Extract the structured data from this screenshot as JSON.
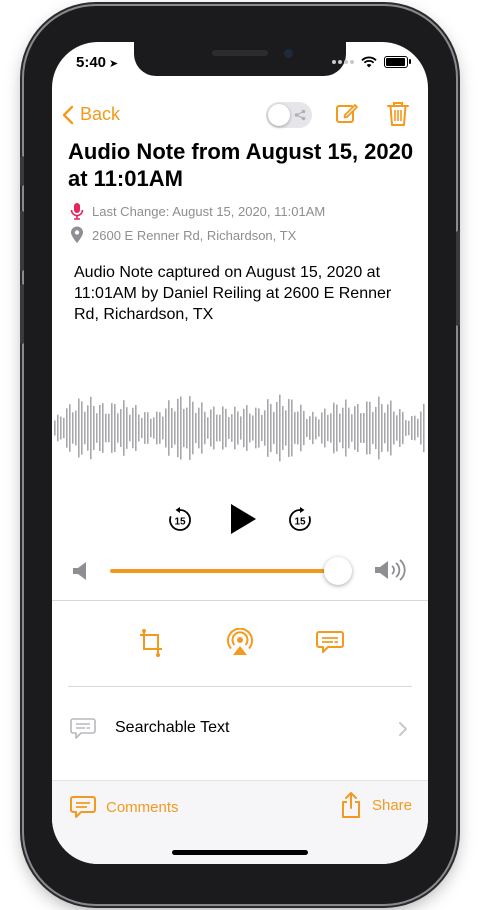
{
  "status_bar": {
    "time": "5:40"
  },
  "nav": {
    "back_label": "Back"
  },
  "note": {
    "title": "Audio Note from August 15, 2020 at 11:01AM",
    "last_change": "Last Change: August 15, 2020, 11:01AM",
    "location": "2600 E Renner Rd, Richardson, TX",
    "description": "Audio Note captured on August 15, 2020 at 11:01AM by Daniel Reiling at 2600 E Renner Rd, Richardson, TX"
  },
  "player": {
    "skip_back_seconds": "15",
    "skip_forward_seconds": "15",
    "volume_level": 0.95
  },
  "list": {
    "searchable_text_label": "Searchable Text"
  },
  "footer": {
    "comments_label": "Comments",
    "share_label": "Share"
  },
  "colors": {
    "accent": "#f39a1e",
    "mic": "#e5265c",
    "secondary_text": "#8e8e93",
    "waveform": "#a8a8ac"
  },
  "icons": [
    "location-arrow-icon",
    "wifi-icon",
    "battery-icon",
    "chevron-left-icon",
    "toggle-switch",
    "compose-icon",
    "trash-icon",
    "microphone-icon",
    "location-pin-icon",
    "skip-back-15-icon",
    "play-icon",
    "skip-forward-15-icon",
    "speaker-low-icon",
    "speaker-high-icon",
    "crop-icon",
    "airplay-icon",
    "transcript-icon",
    "text-bubble-icon",
    "chevron-right-icon",
    "comment-icon",
    "share-icon"
  ]
}
